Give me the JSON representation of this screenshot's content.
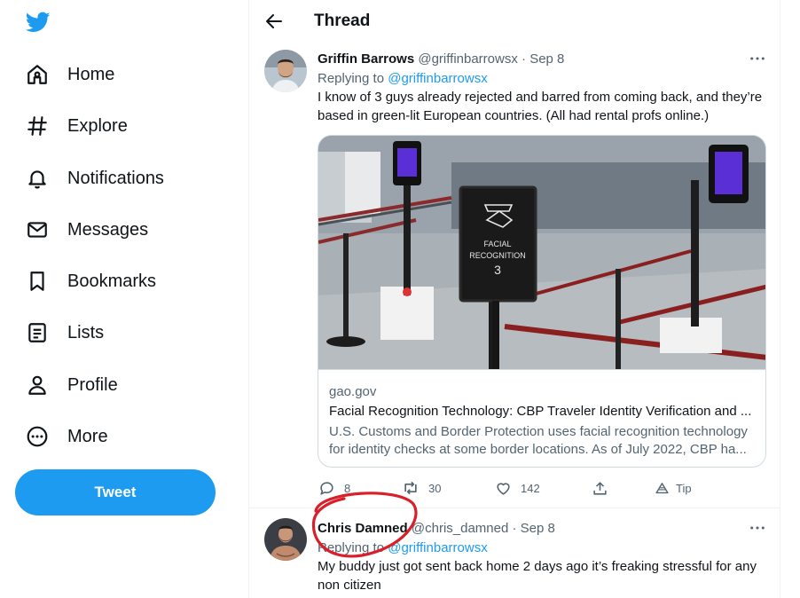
{
  "sidebar": {
    "logo": "twitter-bird-icon",
    "items": [
      {
        "label": "Home",
        "icon": "home-icon"
      },
      {
        "label": "Explore",
        "icon": "hashtag-icon"
      },
      {
        "label": "Notifications",
        "icon": "bell-icon"
      },
      {
        "label": "Messages",
        "icon": "envelope-icon"
      },
      {
        "label": "Bookmarks",
        "icon": "bookmark-icon"
      },
      {
        "label": "Lists",
        "icon": "list-icon"
      },
      {
        "label": "Profile",
        "icon": "person-icon"
      },
      {
        "label": "More",
        "icon": "more-circle-icon"
      }
    ],
    "tweet_button": "Tweet",
    "accent": "#1d9bf0"
  },
  "header": {
    "title": "Thread"
  },
  "tweets": [
    {
      "name": "Griffin Barrows",
      "handle": "@griffinbarrowsx",
      "separator": "·",
      "date": "Sep 8",
      "replying_prefix": "Replying to",
      "replying_to": "@griffinbarrowsx",
      "text": "I know of 3 guys already rejected and barred from coming back, and they’re based in green-lit European countries. (All had rental profs online.)",
      "card": {
        "image_sign_text": [
          "FACIAL",
          "RECOGNITION",
          "3"
        ],
        "domain": "gao.gov",
        "title": "Facial Recognition Technology: CBP Traveler Identity Verification and ...",
        "description": "U.S. Customs and Border Protection uses facial recognition technology for identity checks at some border locations. As of July 2022, CBP ha..."
      },
      "actions": {
        "replies": "8",
        "retweets": "30",
        "likes": "142",
        "tip": "Tip"
      }
    },
    {
      "name": "Chris Damned",
      "handle": "@chris_damned",
      "separator": "·",
      "date": "Sep 8",
      "replying_prefix": "Replying to",
      "replying_to": "@griffinbarrowsx",
      "text": "My buddy just got sent back home 2 days ago it’s freaking stressful for any non citizen"
    }
  ],
  "annotation": {
    "color": "#d9202a"
  }
}
